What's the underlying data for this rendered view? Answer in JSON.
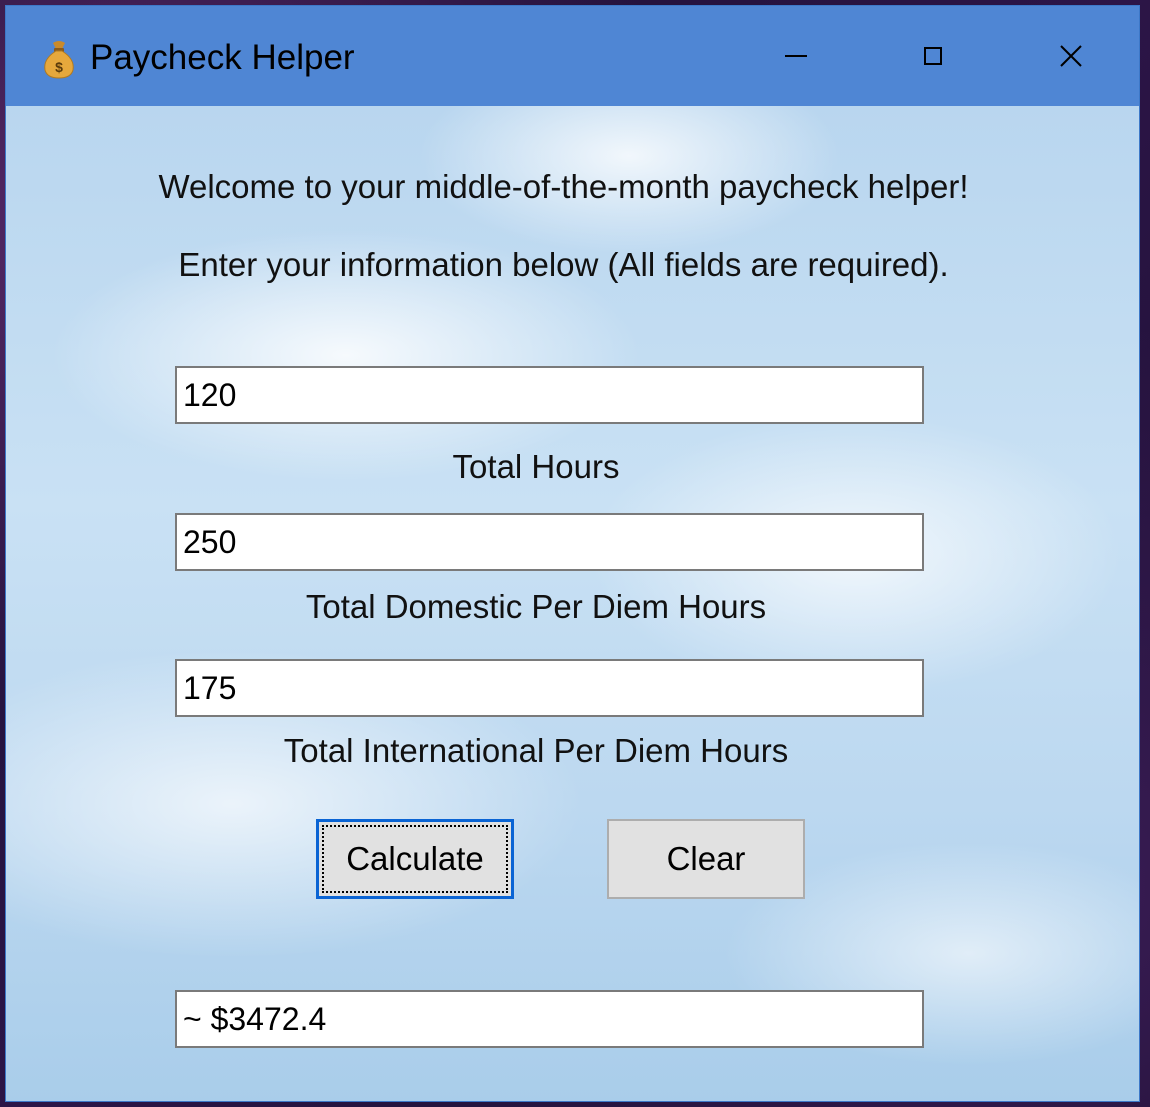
{
  "window": {
    "title": "Paycheck Helper",
    "icon": "money-bag-icon",
    "controls": {
      "minimize": "minimize-icon",
      "maximize": "maximize-icon",
      "close": "close-icon"
    }
  },
  "intro": {
    "welcome": "Welcome to your middle-of-the-month paycheck helper!",
    "instructions": "Enter your information below (All fields are required)."
  },
  "fields": {
    "total_hours": {
      "value": "120",
      "label": "Total Hours"
    },
    "domestic_per_diem_hours": {
      "value": "250",
      "label": "Total Domestic Per Diem Hours"
    },
    "international_per_diem_hours": {
      "value": "175",
      "label": "Total International Per Diem Hours"
    }
  },
  "buttons": {
    "calculate": "Calculate",
    "clear": "Clear"
  },
  "result": {
    "value": "~ $3472.4"
  },
  "colors": {
    "titlebar": "#4f86d4",
    "focus_border": "#0a64d4",
    "button_face": "#e1e1e1"
  }
}
